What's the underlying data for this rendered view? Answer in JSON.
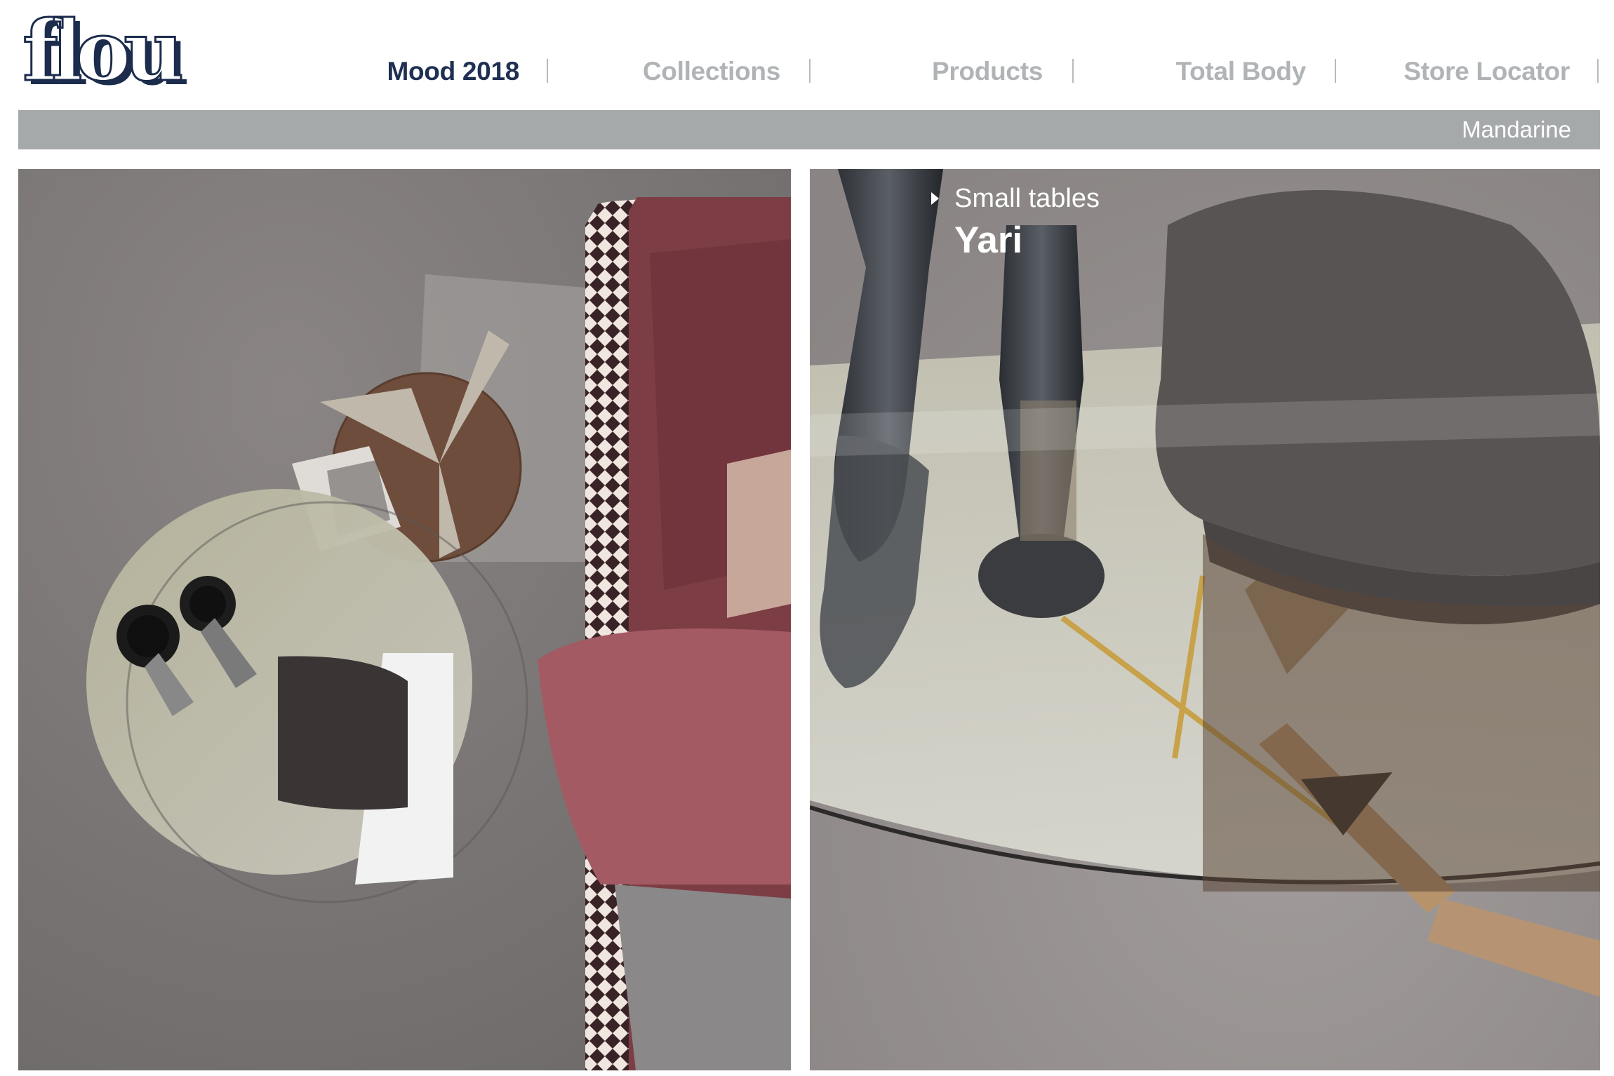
{
  "brand": {
    "logo_text": "flou"
  },
  "nav": {
    "items": [
      {
        "label": "Mood 2018",
        "active": true
      },
      {
        "label": "Collections",
        "active": false
      },
      {
        "label": "Products",
        "active": false
      },
      {
        "label": "Total Body",
        "active": false
      },
      {
        "label": "Store Locator",
        "active": false
      }
    ]
  },
  "subbar": {
    "label": "Mandarine"
  },
  "product": {
    "category": "Small tables",
    "name": "Yari"
  },
  "colors": {
    "brand_navy": "#1f2f52",
    "nav_inactive": "#b1b4b6",
    "subbar_bg": "#a5a9aa"
  }
}
